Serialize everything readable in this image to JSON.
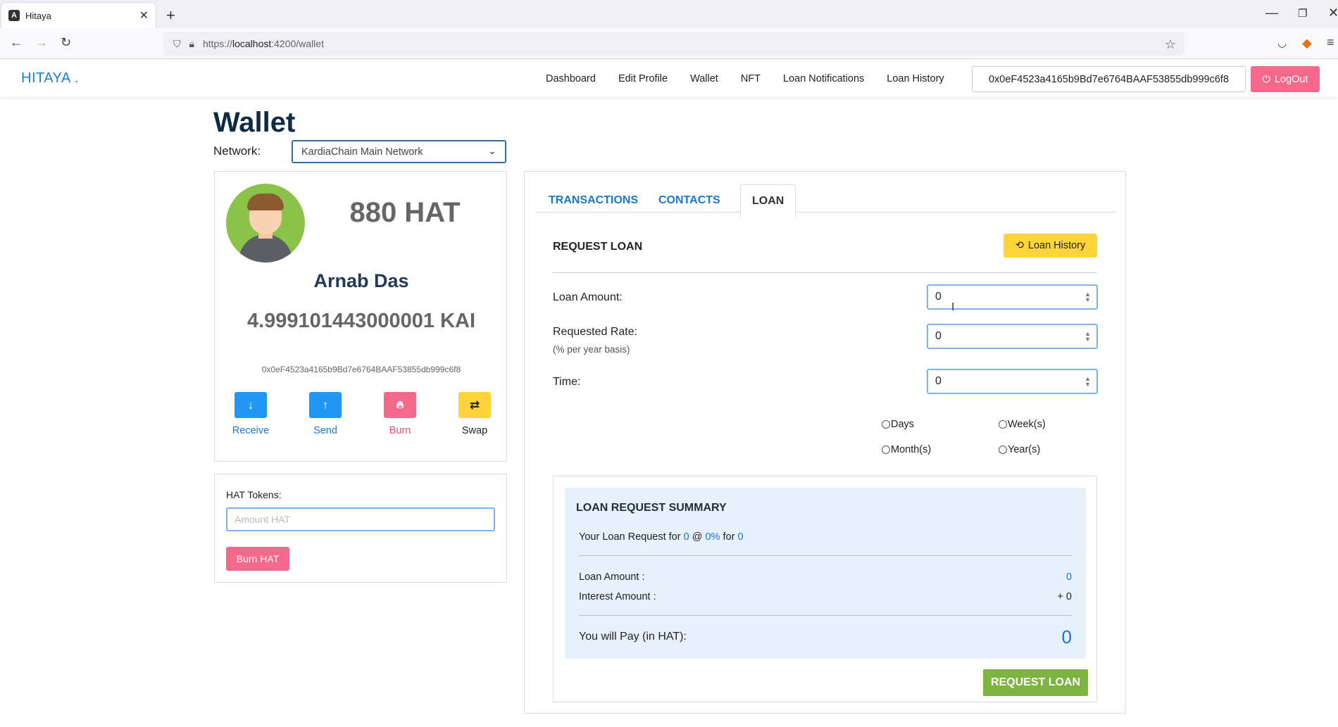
{
  "browser": {
    "tab_title": "Hitaya",
    "tab_favicon": "A",
    "url_prefix": "https://",
    "url_host": "localhost",
    "url_rest": ":4200/wallet"
  },
  "app": {
    "brand": "HITAYA .",
    "menu": [
      "Dashboard",
      "Edit Profile",
      "Wallet",
      "NFT",
      "Loan Notifications",
      "Loan History"
    ],
    "wallet_address": "0x0eF4523a4165b9Bd7e6764BAAF53855db999c6f8",
    "logout_label": "LogOut"
  },
  "page": {
    "title": "Wallet",
    "network_label": "Network:",
    "network_value": "KardiaChain Main Network"
  },
  "profile": {
    "hat_balance": "880 HAT",
    "name": "Arnab Das",
    "kai_balance": "4.999101443000001 KAI",
    "address": "0x0eF4523a4165b9Bd7e6764BAAF53855db999c6f8",
    "actions": [
      {
        "label": "Receive",
        "icon": "arrow-down-icon",
        "color": "#2196f3",
        "text_color": "#1976d2"
      },
      {
        "label": "Send",
        "icon": "arrow-up-icon",
        "color": "#2196f3",
        "text_color": "#1976d2"
      },
      {
        "label": "Burn",
        "icon": "fire-icon",
        "color": "#f3688b",
        "text_color": "#e0506f"
      },
      {
        "label": "Swap",
        "icon": "swap-icon",
        "color": "#ffd43b",
        "text_color": "#222222"
      }
    ]
  },
  "burn": {
    "label": "HAT Tokens:",
    "placeholder": "Amount  HAT",
    "button": "Burn HAT"
  },
  "tabs": [
    "TRANSACTIONS",
    "CONTACTS",
    "LOAN"
  ],
  "loan": {
    "title": "REQUEST LOAN",
    "history_button": "Loan History",
    "amount_label": "Loan Amount:",
    "amount_value": "0",
    "rate_label": "Requested Rate:",
    "rate_sub": "(% per year basis)",
    "rate_value": "0",
    "time_label": "Time:",
    "time_value": "0",
    "units": [
      "Days",
      "Week(s)",
      "Month(s)",
      "Year(s)"
    ]
  },
  "summary": {
    "title": "LOAN REQUEST SUMMARY",
    "line_prefix": "Your Loan Request for",
    "line_amount": "0",
    "line_at": "@",
    "line_rate": "0%",
    "line_for": "for",
    "line_time": "0",
    "loan_amount_label": "Loan Amount :",
    "loan_amount_value": "0",
    "interest_label": "Interest Amount :",
    "interest_value": "+ 0",
    "pay_label": "You will Pay (in HAT):",
    "pay_value": "0",
    "request_button": "REQUEST LOAN"
  }
}
